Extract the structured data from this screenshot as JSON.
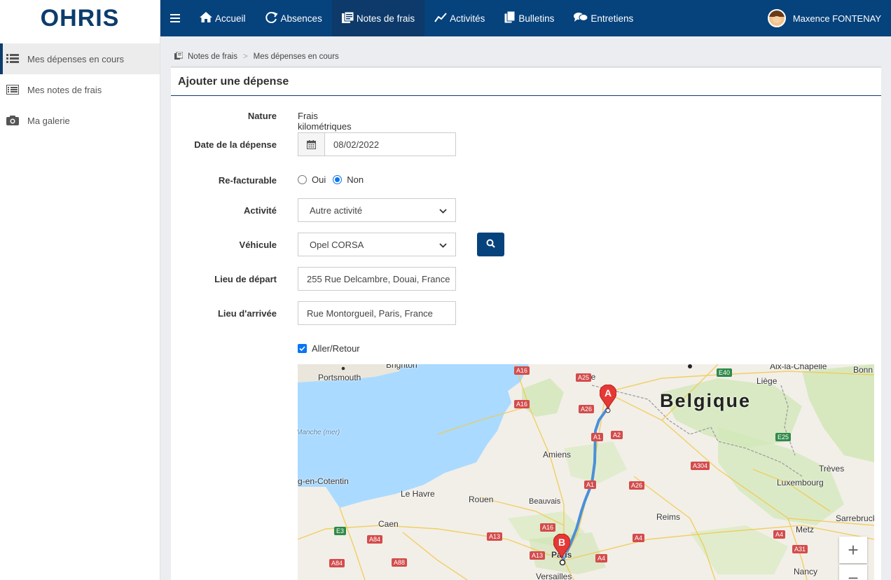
{
  "brand": {
    "logo_text": "OHRIS"
  },
  "sidebar": {
    "items": [
      {
        "label": "Mes dépenses en cours",
        "icon": "list-icon",
        "active": true
      },
      {
        "label": "Mes notes de frais",
        "icon": "card-list-icon",
        "active": false
      },
      {
        "label": "Ma galerie",
        "icon": "camera-icon",
        "active": false
      }
    ]
  },
  "nav": {
    "items": [
      {
        "label": "Accueil",
        "icon": "home-icon"
      },
      {
        "label": "Absences",
        "icon": "absence-icon"
      },
      {
        "label": "Notes de frais",
        "icon": "expense-icon",
        "active": true
      },
      {
        "label": "Activités",
        "icon": "chart-line-icon"
      },
      {
        "label": "Bulletins",
        "icon": "files-icon"
      },
      {
        "label": "Entretiens",
        "icon": "comments-icon"
      }
    ],
    "user_name": "Maxence FONTENAY"
  },
  "breadcrumb": {
    "first": "Notes de frais",
    "separator": ">",
    "current": "Mes dépenses en cours"
  },
  "panel": {
    "title": "Ajouter une dépense"
  },
  "form": {
    "nature_label": "Nature",
    "nature_value": "Frais kilométriques",
    "date_label": "Date de la dépense",
    "date_value": "08/02/2022",
    "refacturable_label": "Re-facturable",
    "oui_label": "Oui",
    "non_label": "Non",
    "refacturable_selected": "Non",
    "activite_label": "Activité",
    "activite_value": "Autre activité",
    "vehicule_label": "Véhicule",
    "vehicule_value": "Opel CORSA",
    "depart_label": "Lieu de départ",
    "depart_value": "255 Rue Delcambre, Douai, France",
    "arrivee_label": "Lieu d'arrivée",
    "arrivee_value": "Rue Montorgueil, Paris, France",
    "aller_retour_label": "Aller/Retour",
    "aller_retour_checked": true
  },
  "map": {
    "country_label": "Belgique",
    "cities": {
      "brighton": "Brighton",
      "portsmouth": "Portsmouth",
      "lille": "Lille",
      "aix": "Aix-la-Chapelle",
      "bonn": "Bonn",
      "liege": "Liège",
      "manche": "Manche (mer)",
      "amiens": "Amiens",
      "treves": "Trèves",
      "cotentin": "Cherbourg-en-Cotentin",
      "luxembourg": "Luxembourg",
      "lehavre": "Le Havre",
      "rouen": "Rouen",
      "beauvais": "Beauvais",
      "caen": "Caen",
      "reims": "Reims",
      "sarrebruck": "Sarrebruck",
      "metz": "Metz",
      "paris": "Paris",
      "versailles": "Versailles",
      "nancy": "Nancy"
    },
    "roads": [
      "A16",
      "E40",
      "A25",
      "A16",
      "A26",
      "A2",
      "A1",
      "E25",
      "A304",
      "A26",
      "A1",
      "E3",
      "A84",
      "A13",
      "A16",
      "A4",
      "A4",
      "A84",
      "A88",
      "A13",
      "A4",
      "A31"
    ],
    "marker_a": "A",
    "marker_b": "B",
    "zoom_in": "+",
    "zoom_out": "−"
  },
  "colors": {
    "primary": "#06427c",
    "accent": "#0a75f2",
    "route": "#4a90d9",
    "marker": "#e53935"
  }
}
